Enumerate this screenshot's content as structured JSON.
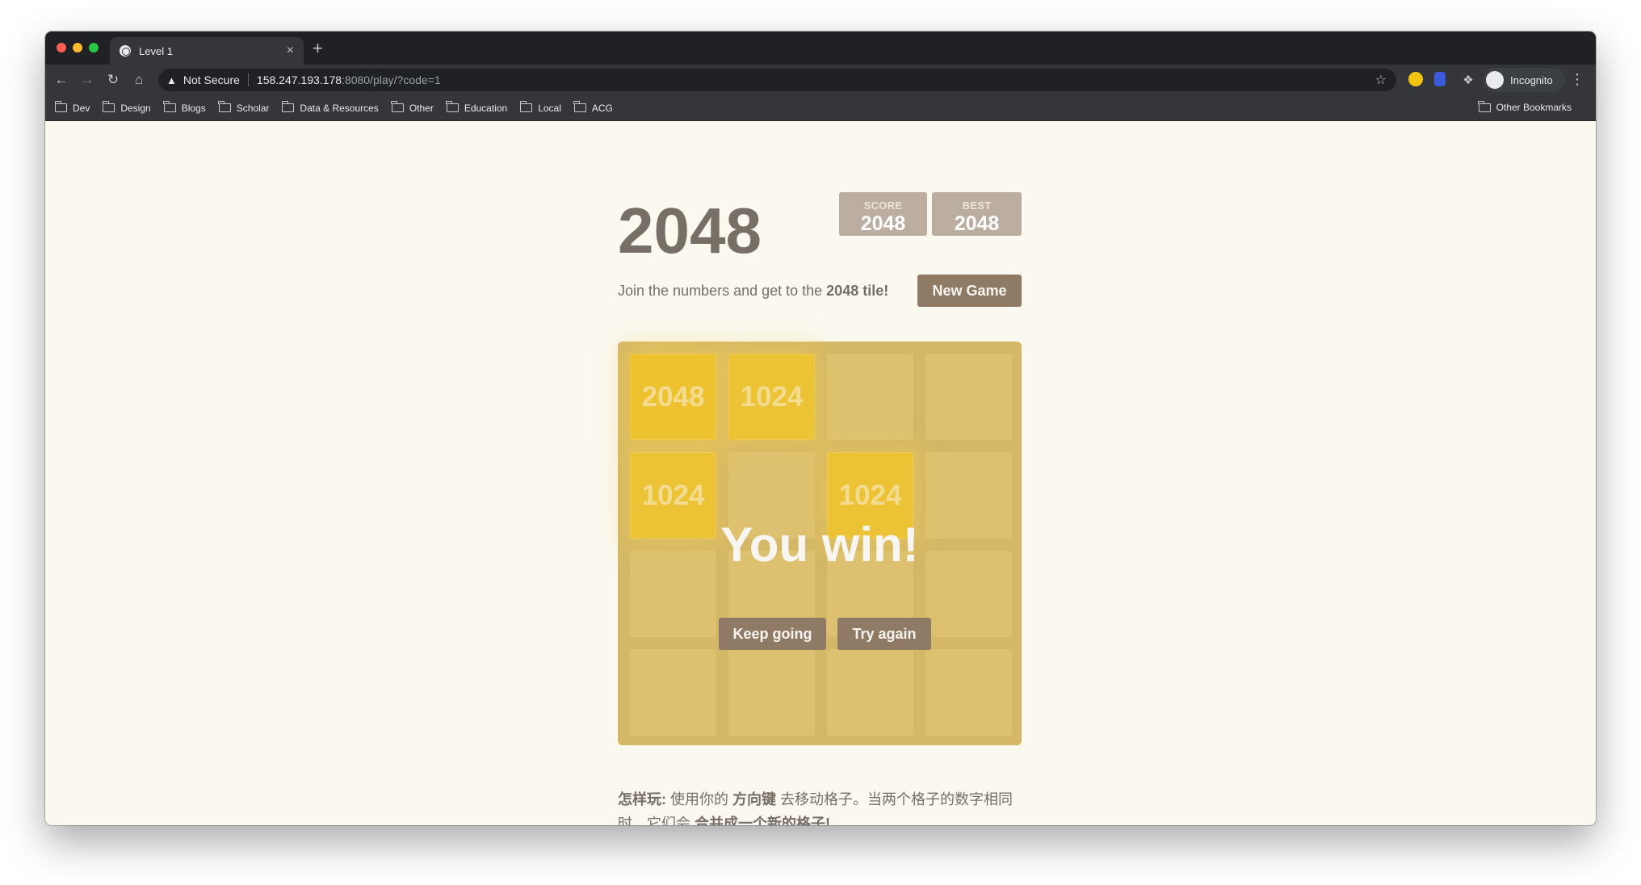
{
  "browser": {
    "tab_title": "Level 1",
    "tab_close": "×",
    "new_tab": "+",
    "security_label": "Not Secure",
    "url_host": "158.247.193.178",
    "url_path": ":8080/play/?code=1",
    "profile_label": "Incognito",
    "bookmarks": [
      "Dev",
      "Design",
      "Blogs",
      "Scholar",
      "Data & Resources",
      "Other",
      "Education",
      "Local",
      "ACG"
    ],
    "other_bookmarks": "Other Bookmarks"
  },
  "game": {
    "title": "2048",
    "score_label": "SCORE",
    "score_value": "2048",
    "best_label": "BEST",
    "best_value": "2048",
    "intro_text": "Join the numbers and get to the ",
    "intro_bold": "2048 tile!",
    "new_game_label": "New Game",
    "tiles": [
      {
        "row": 0,
        "col": 0,
        "value": "2048"
      },
      {
        "row": 0,
        "col": 1,
        "value": "1024"
      },
      {
        "row": 1,
        "col": 0,
        "value": "1024"
      },
      {
        "row": 1,
        "col": 2,
        "value": "1024"
      }
    ],
    "win_message": "You win!",
    "keep_going_label": "Keep going",
    "try_again_label": "Try again",
    "howto_label": "怎样玩:",
    "howto_text1": " 使用你的 ",
    "howto_keys": "方向键",
    "howto_text2": " 去移动格子。当两个格子的数字相同时，它们会 ",
    "howto_merge": "合并成一个新的格子!"
  },
  "colors": {
    "tile_2048": "#edc22e",
    "board": "#bbada0",
    "button": "#8f7a66",
    "page_bg": "#faf8ef"
  }
}
